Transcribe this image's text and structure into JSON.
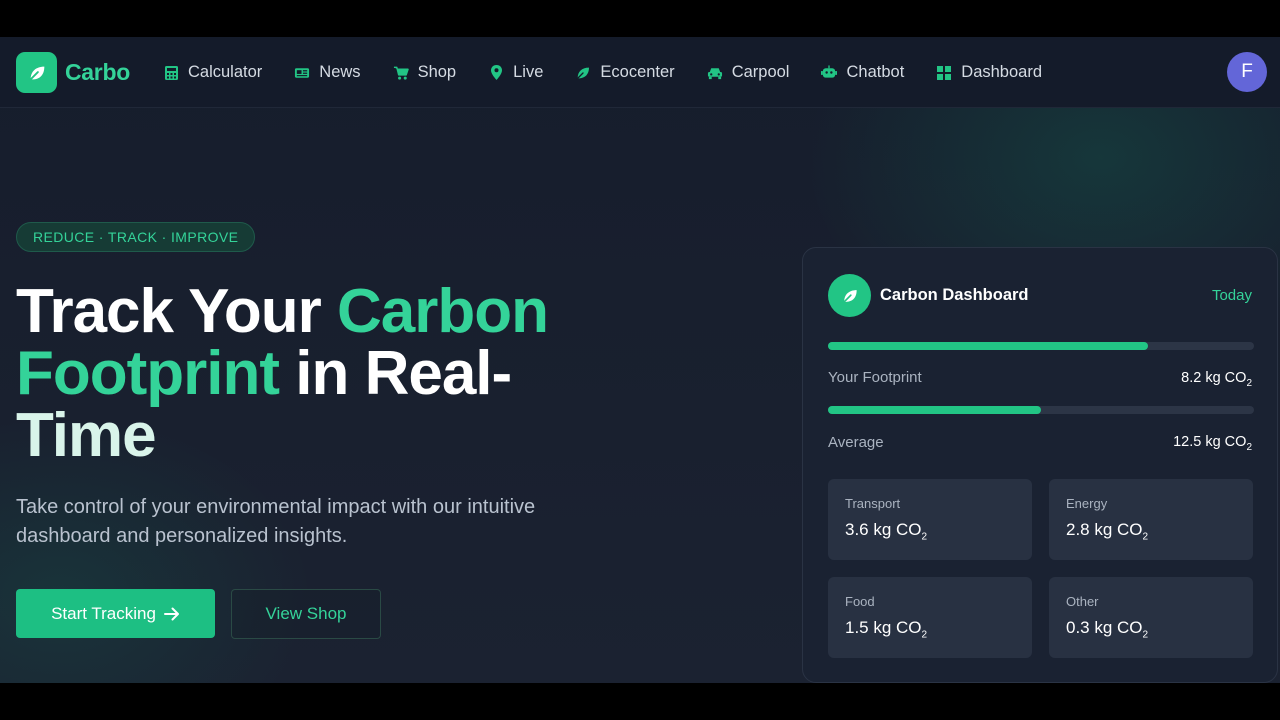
{
  "brand": {
    "name": "Carbo",
    "icon": "leaf-icon",
    "color": "#34d399"
  },
  "nav": {
    "items": [
      {
        "label": "Calculator",
        "icon": "calculator-icon"
      },
      {
        "label": "News",
        "icon": "newspaper-icon"
      },
      {
        "label": "Shop",
        "icon": "cart-icon"
      },
      {
        "label": "Live",
        "icon": "map-pin-icon"
      },
      {
        "label": "Ecocenter",
        "icon": "leaf-icon"
      },
      {
        "label": "Carpool",
        "icon": "car-icon"
      },
      {
        "label": "Chatbot",
        "icon": "robot-icon"
      },
      {
        "label": "Dashboard",
        "icon": "grid-icon"
      }
    ],
    "avatar_initial": "F"
  },
  "hero": {
    "tagline": "REDUCE · TRACK · IMPROVE",
    "headline_part1": "Track Your ",
    "headline_accent1": "Carbon",
    "headline_accent2": "Footprint",
    "headline_part2": " in Real-",
    "headline_part3": "Time",
    "subtitle": "Take control of your environmental impact with our intuitive dashboard and personalized insights.",
    "primary_button": "Start Tracking",
    "secondary_button": "View Shop"
  },
  "dashboard_card": {
    "title": "Carbon Dashboard",
    "period": "Today",
    "footprint": {
      "label": "Your Footprint",
      "value": "8.2 kg CO",
      "unit_sub": "2",
      "progress": 0.75
    },
    "average": {
      "label": "Average",
      "value": "12.5 kg CO",
      "unit_sub": "2",
      "progress": 0.5
    },
    "tiles": [
      {
        "label": "Transport",
        "value": "3.6 kg CO",
        "unit_sub": "2"
      },
      {
        "label": "Energy",
        "value": "2.8 kg CO",
        "unit_sub": "2"
      },
      {
        "label": "Food",
        "value": "1.5 kg CO",
        "unit_sub": "2"
      },
      {
        "label": "Other",
        "value": "0.3 kg CO",
        "unit_sub": "2"
      }
    ]
  },
  "colors": {
    "accent": "#22c585",
    "background": "#1b2231",
    "avatar": "#6366d8"
  }
}
